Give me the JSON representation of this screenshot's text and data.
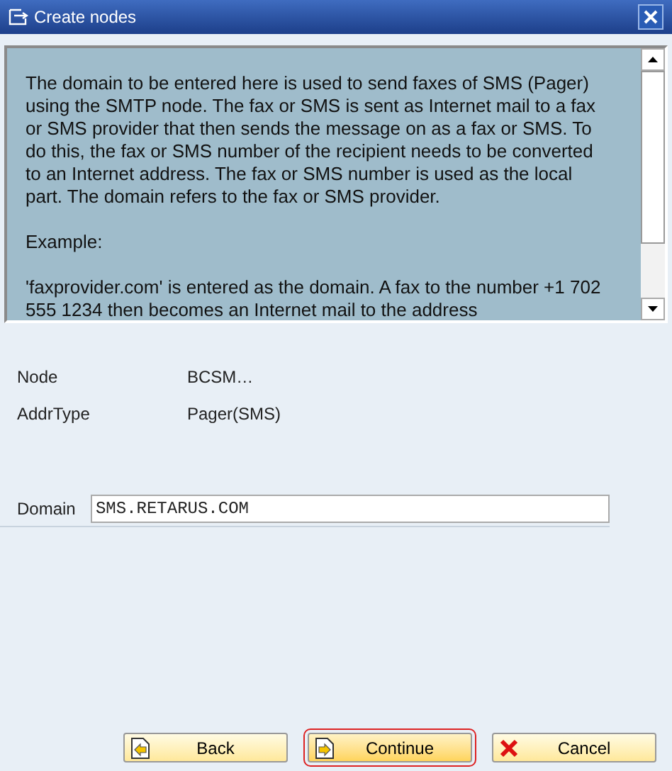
{
  "window": {
    "title": "Create nodes"
  },
  "help_text": [
    "The domain to be entered here is used to send faxes of SMS (Pager) using the SMTP node. The fax or SMS is sent as Internet mail to a fax or SMS provider that then sends the message on as a fax or SMS. To do this, the fax or SMS number of the recipient needs to be converted to an Internet address. The fax or SMS number is used as the local part. The domain refers to the fax or SMS provider.",
    "Example:",
    "'faxprovider.com' is entered as the domain. A fax to the number +1 702 555 1234 then becomes an Internet mail to the address"
  ],
  "info": [
    {
      "label": "Node",
      "value": "BCSM…"
    },
    {
      "label": "AddrType",
      "value": "Pager(SMS)"
    }
  ],
  "domain": {
    "label": "Domain",
    "value": "SMS.RETARUS.COM"
  },
  "buttons": [
    {
      "label": "Back",
      "kind": "back",
      "focused": false
    },
    {
      "label": "Continue",
      "kind": "continue",
      "focused": true
    },
    {
      "label": "Cancel",
      "kind": "cancel",
      "focused": false
    }
  ]
}
